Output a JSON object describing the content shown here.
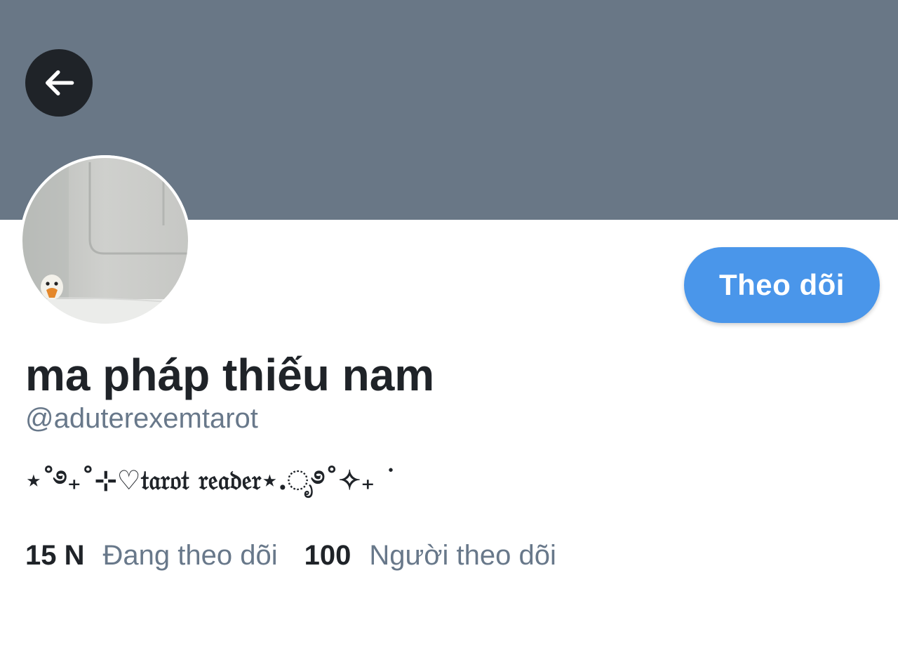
{
  "header": {
    "banner_color": "#697786",
    "back_icon": "arrow-left-icon"
  },
  "profile": {
    "display_name": "ma pháp thiếu nam",
    "handle": "@aduterexemtarot",
    "bio": "⋆˚࿔₊˚⊹♡𝔱𝔞𝔯𝔬𝔱 𝔯𝔢𝔞𝔡𝔢𝔯⋆.ೃ࿔˚✧₊ ˙",
    "avatar": "avatar-photo-duck"
  },
  "actions": {
    "follow_label": "Theo dõi",
    "accent_color": "#4a96ea"
  },
  "stats": {
    "following_count": "15 N",
    "following_label": "Đang theo dõi",
    "followers_count": "100",
    "followers_label": "Người theo dõi"
  }
}
